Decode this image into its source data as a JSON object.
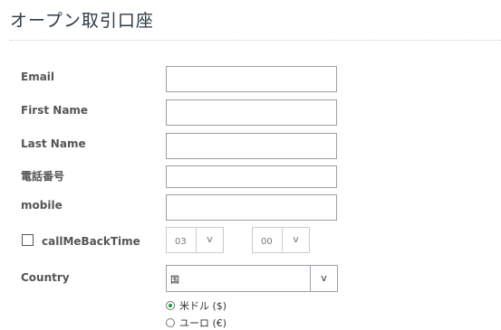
{
  "page": {
    "title": "オープン取引口座"
  },
  "form": {
    "email_label": "Email",
    "first_name_label": "First Name",
    "last_name_label": "Last Name",
    "phone_label": "電話番号",
    "mobile_label": "mobile",
    "callback_label": "callMeBackTime",
    "callback_checked": false,
    "callback_hour": "03",
    "callback_minute": "00",
    "dropdown_arrow": "v",
    "country_label": "Country",
    "country_value": "国",
    "currencies": [
      {
        "label": "米ドル ($)",
        "checked": true
      },
      {
        "label": "ユーロ (€)",
        "checked": false
      }
    ]
  },
  "colors": {
    "radio_selected": "#1a9a3b",
    "field_border": "#9aa0a6"
  }
}
